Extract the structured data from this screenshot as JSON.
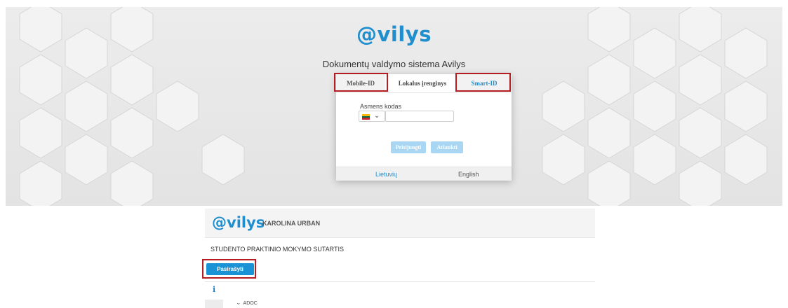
{
  "login": {
    "logo": "@vilys",
    "subtitle": "Dokumentų valdymo sistema Avilys",
    "tabs": [
      "Mobile-ID",
      "Lokalus įrenginys",
      "Smart-ID"
    ],
    "personal_code_label": "Asmens kodas",
    "personal_code_value": "",
    "country_flag": "lithuania-flag-icon",
    "buttons": {
      "connect": "Prisijungti",
      "cancel": "Atšaukti"
    },
    "languages": {
      "lithuanian": "Lietuvių",
      "english": "English"
    }
  },
  "document": {
    "logo": "@vilys",
    "user_name": "KAROLINA URBAN",
    "title": "STUDENTO PRAKTINIO MOKYMO SUTARTIS",
    "sign_button": "Pasirašyti",
    "info_icon_glyph": "i",
    "tree_node": "ADOC"
  },
  "colors": {
    "brand_blue": "#1f8ecf",
    "button_blue": "#1a93d6",
    "disabled_button": "#a9d7f3",
    "highlight_red": "#b61d22"
  }
}
